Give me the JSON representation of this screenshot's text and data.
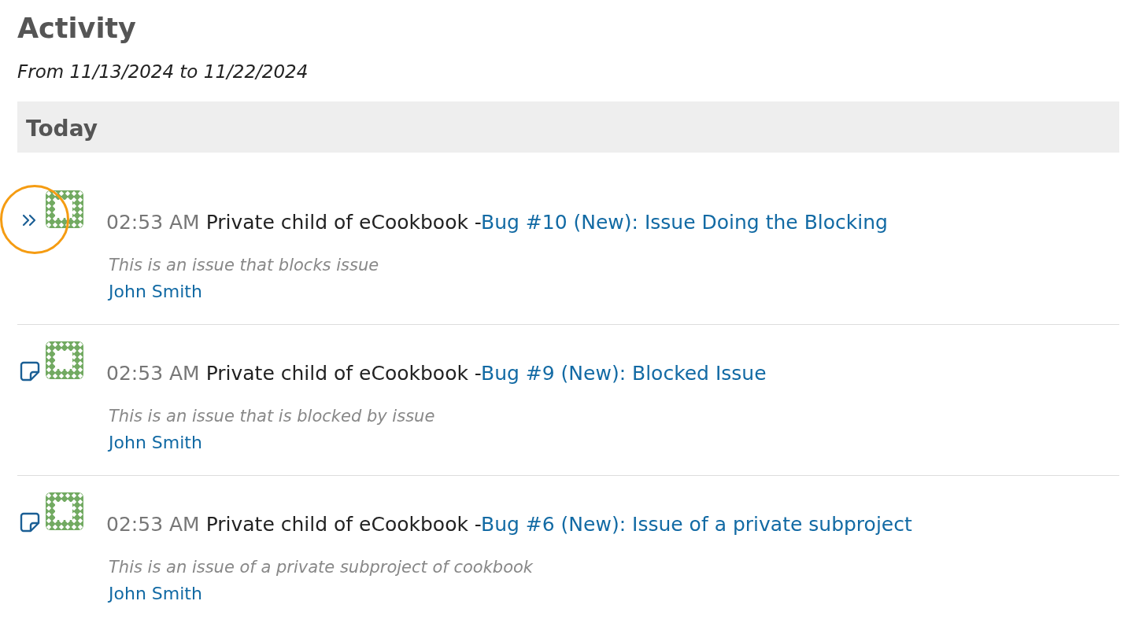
{
  "page": {
    "title": "Activity",
    "date_range": "From 11/13/2024 to 11/22/2024"
  },
  "days": [
    {
      "heading": "Today",
      "events": [
        {
          "kind": "relation",
          "highlighted": true,
          "time": "02:53 AM",
          "project": "Private child of eCookbook -",
          "link": "Bug #10 (New): Issue Doing the Blocking",
          "description": "This is an issue that blocks issue",
          "author": "John Smith"
        },
        {
          "kind": "note",
          "highlighted": false,
          "time": "02:53 AM",
          "project": "Private child of eCookbook -",
          "link": "Bug #9 (New): Blocked Issue",
          "description": "This is an issue that is blocked by issue",
          "author": "John Smith"
        },
        {
          "kind": "note",
          "highlighted": false,
          "time": "02:53 AM",
          "project": "Private child of eCookbook -",
          "link": "Bug #6 (New): Issue of a private subproject",
          "description": "This is an issue of a private subproject of cookbook",
          "author": "John Smith"
        }
      ]
    }
  ]
}
